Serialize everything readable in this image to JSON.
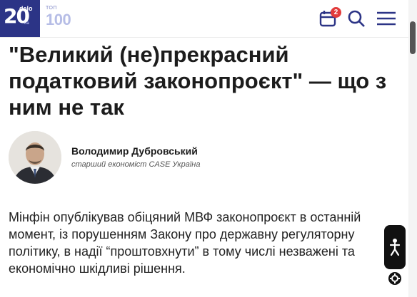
{
  "header": {
    "logo": {
      "number": "20",
      "brand": "delo",
      "suffix": "ua"
    },
    "top100": {
      "small_label": "ТОП",
      "big_label": "100"
    },
    "calendar_badge_count": "2",
    "icons": [
      "calendar-icon",
      "search-icon",
      "menu-icon"
    ],
    "colors": {
      "logo_bg": "#2c3486",
      "accent": "#2c3486",
      "badge": "#e23b3b"
    }
  },
  "article": {
    "title": "\"Великий (не)прекрасний податковий законопроєкт\" — що з ним не так",
    "author": {
      "name": "Володимир Дубровський",
      "role": "старший економіст CASE Україна"
    },
    "lead": "Мінфін опублікував обіцяний МВФ законопроєкт в останній момент, із порушенням Закону про державну регуляторну політику, в надії “проштовхнути” в тому числі незважені та економічно шкідливі рішення."
  },
  "widgets": {
    "accessibility_icon": "accessibility-icon",
    "settings_icon": "gear-icon"
  }
}
